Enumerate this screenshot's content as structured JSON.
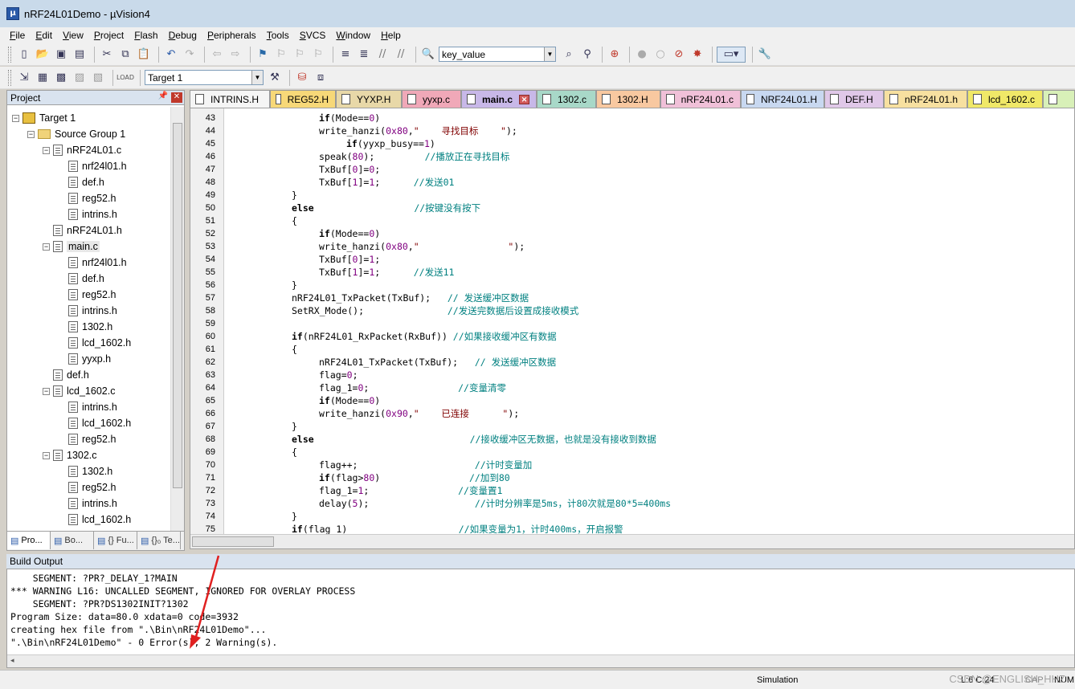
{
  "window": {
    "title": "nRF24L01Demo  - µVision4"
  },
  "menu": [
    "File",
    "Edit",
    "View",
    "Project",
    "Flash",
    "Debug",
    "Peripherals",
    "Tools",
    "SVCS",
    "Window",
    "Help"
  ],
  "toolbar": {
    "find_combo_value": "key_value",
    "target_combo_value": "Target 1"
  },
  "project_panel": {
    "title": "Project",
    "tree": [
      {
        "label": "Target 1",
        "level": 0,
        "kind": "target",
        "expander": "-"
      },
      {
        "label": "Source Group 1",
        "level": 1,
        "kind": "folder",
        "expander": "-"
      },
      {
        "label": "nRF24L01.c",
        "level": 2,
        "kind": "file",
        "expander": "-"
      },
      {
        "label": "nrf24l01.h",
        "level": 3,
        "kind": "file"
      },
      {
        "label": "def.h",
        "level": 3,
        "kind": "file"
      },
      {
        "label": "reg52.h",
        "level": 3,
        "kind": "file"
      },
      {
        "label": "intrins.h",
        "level": 3,
        "kind": "file"
      },
      {
        "label": "nRF24L01.h",
        "level": 2,
        "kind": "file"
      },
      {
        "label": "main.c",
        "level": 2,
        "kind": "file",
        "expander": "-"
      },
      {
        "label": "nrf24l01.h",
        "level": 3,
        "kind": "file"
      },
      {
        "label": "def.h",
        "level": 3,
        "kind": "file"
      },
      {
        "label": "reg52.h",
        "level": 3,
        "kind": "file"
      },
      {
        "label": "intrins.h",
        "level": 3,
        "kind": "file"
      },
      {
        "label": "1302.h",
        "level": 3,
        "kind": "file"
      },
      {
        "label": "lcd_1602.h",
        "level": 3,
        "kind": "file"
      },
      {
        "label": "yyxp.h",
        "level": 3,
        "kind": "file"
      },
      {
        "label": "def.h",
        "level": 2,
        "kind": "file"
      },
      {
        "label": "lcd_1602.c",
        "level": 2,
        "kind": "file",
        "expander": "-"
      },
      {
        "label": "intrins.h",
        "level": 3,
        "kind": "file"
      },
      {
        "label": "lcd_1602.h",
        "level": 3,
        "kind": "file"
      },
      {
        "label": "reg52.h",
        "level": 3,
        "kind": "file"
      },
      {
        "label": "1302.c",
        "level": 2,
        "kind": "file",
        "expander": "-"
      },
      {
        "label": "1302.h",
        "level": 3,
        "kind": "file"
      },
      {
        "label": "reg52.h",
        "level": 3,
        "kind": "file"
      },
      {
        "label": "intrins.h",
        "level": 3,
        "kind": "file"
      },
      {
        "label": "lcd_1602.h",
        "level": 3,
        "kind": "file"
      }
    ],
    "tabs": [
      "Pro...",
      "Bo...",
      "{} Fu...",
      "{}₀ Te..."
    ]
  },
  "editor": {
    "tabs": [
      {
        "label": "INTRINS.H",
        "color": "#f5f5f5"
      },
      {
        "label": "REG52.H",
        "color": "#f7d878"
      },
      {
        "label": "YYXP.H",
        "color": "#e8d8a8"
      },
      {
        "label": "yyxp.c",
        "color": "#f0a8b8"
      },
      {
        "label": "main.c",
        "color": "#c8b8e8",
        "active": true
      },
      {
        "label": "1302.c",
        "color": "#a8d8c8"
      },
      {
        "label": "1302.H",
        "color": "#f8c8a0"
      },
      {
        "label": "nRF24L01.c",
        "color": "#f0c0d8"
      },
      {
        "label": "NRF24L01.H",
        "color": "#c8d8f0"
      },
      {
        "label": "DEF.H",
        "color": "#e0c8e8"
      },
      {
        "label": "nRF24L01.h",
        "color": "#f7e0a0"
      },
      {
        "label": "lcd_1602.c",
        "color": "#f0e868"
      },
      {
        "label": "",
        "color": "#d8f0b8"
      }
    ],
    "lines": [
      {
        "n": "43",
        "indent": 12,
        "segs": [
          {
            "t": "if",
            "c": "kw"
          },
          {
            "t": "(Mode=="
          },
          {
            "t": "0",
            "c": "num"
          },
          {
            "t": ")"
          }
        ]
      },
      {
        "n": "44",
        "indent": 12,
        "segs": [
          {
            "t": "write_hanzi("
          },
          {
            "t": "0x80",
            "c": "num"
          },
          {
            "t": ","
          },
          {
            "t": "\"    寻找目标    \"",
            "c": "str"
          },
          {
            "t": ");"
          }
        ]
      },
      {
        "n": "45",
        "indent": 16,
        "segs": [
          {
            "t": "if",
            "c": "kw"
          },
          {
            "t": "(yyxp_busy=="
          },
          {
            "t": "1",
            "c": "num"
          },
          {
            "t": ")"
          }
        ]
      },
      {
        "n": "46",
        "indent": 12,
        "segs": [
          {
            "t": "speak("
          },
          {
            "t": "80",
            "c": "num"
          },
          {
            "t": ");         "
          },
          {
            "t": "//播放正在寻找目标",
            "c": "cmt"
          }
        ]
      },
      {
        "n": "47",
        "indent": 12,
        "segs": [
          {
            "t": "TxBuf["
          },
          {
            "t": "0",
            "c": "num"
          },
          {
            "t": "]="
          },
          {
            "t": "0",
            "c": "num"
          },
          {
            "t": ";"
          }
        ]
      },
      {
        "n": "48",
        "indent": 12,
        "segs": [
          {
            "t": "TxBuf["
          },
          {
            "t": "1",
            "c": "num"
          },
          {
            "t": "]="
          },
          {
            "t": "1",
            "c": "num"
          },
          {
            "t": ";      "
          },
          {
            "t": "//发送01",
            "c": "cmt"
          }
        ]
      },
      {
        "n": "49",
        "indent": 8,
        "segs": [
          {
            "t": "}"
          }
        ]
      },
      {
        "n": "50",
        "indent": 8,
        "segs": [
          {
            "t": "else",
            "c": "kw"
          },
          {
            "t": "                  "
          },
          {
            "t": "//按键没有按下",
            "c": "cmt"
          }
        ]
      },
      {
        "n": "51",
        "indent": 8,
        "segs": [
          {
            "t": "{"
          }
        ]
      },
      {
        "n": "52",
        "indent": 12,
        "segs": [
          {
            "t": "if",
            "c": "kw"
          },
          {
            "t": "(Mode=="
          },
          {
            "t": "0",
            "c": "num"
          },
          {
            "t": ")"
          }
        ]
      },
      {
        "n": "53",
        "indent": 12,
        "segs": [
          {
            "t": "write_hanzi("
          },
          {
            "t": "0x80",
            "c": "num"
          },
          {
            "t": ","
          },
          {
            "t": "\"                \"",
            "c": "str"
          },
          {
            "t": ");"
          }
        ]
      },
      {
        "n": "54",
        "indent": 12,
        "segs": [
          {
            "t": "TxBuf["
          },
          {
            "t": "0",
            "c": "num"
          },
          {
            "t": "]="
          },
          {
            "t": "1",
            "c": "num"
          },
          {
            "t": ";"
          }
        ]
      },
      {
        "n": "55",
        "indent": 12,
        "segs": [
          {
            "t": "TxBuf["
          },
          {
            "t": "1",
            "c": "num"
          },
          {
            "t": "]="
          },
          {
            "t": "1",
            "c": "num"
          },
          {
            "t": ";      "
          },
          {
            "t": "//发送11",
            "c": "cmt"
          }
        ]
      },
      {
        "n": "56",
        "indent": 8,
        "segs": [
          {
            "t": "}"
          }
        ]
      },
      {
        "n": "57",
        "indent": 8,
        "segs": [
          {
            "t": "nRF24L01_TxPacket(TxBuf);   "
          },
          {
            "t": "// 发送缓冲区数据",
            "c": "cmt"
          }
        ]
      },
      {
        "n": "58",
        "indent": 8,
        "segs": [
          {
            "t": "SetRX_Mode();               "
          },
          {
            "t": "//发送完数据后设置成接收模式",
            "c": "cmt"
          }
        ]
      },
      {
        "n": "59",
        "indent": 8,
        "segs": [
          {
            "t": ""
          }
        ]
      },
      {
        "n": "60",
        "indent": 8,
        "segs": [
          {
            "t": "if",
            "c": "kw"
          },
          {
            "t": "(nRF24L01_RxPacket(RxBuf)) "
          },
          {
            "t": "//如果接收缓冲区有数据",
            "c": "cmt"
          }
        ]
      },
      {
        "n": "61",
        "indent": 8,
        "segs": [
          {
            "t": "{"
          }
        ]
      },
      {
        "n": "62",
        "indent": 12,
        "segs": [
          {
            "t": "nRF24L01_TxPacket(TxBuf);   "
          },
          {
            "t": "// 发送缓冲区数据",
            "c": "cmt"
          }
        ]
      },
      {
        "n": "63",
        "indent": 12,
        "segs": [
          {
            "t": "flag="
          },
          {
            "t": "0",
            "c": "num"
          },
          {
            "t": ";"
          }
        ]
      },
      {
        "n": "64",
        "indent": 12,
        "segs": [
          {
            "t": "flag_1="
          },
          {
            "t": "0",
            "c": "num"
          },
          {
            "t": ";                "
          },
          {
            "t": "//变量清零",
            "c": "cmt"
          }
        ]
      },
      {
        "n": "65",
        "indent": 12,
        "segs": [
          {
            "t": "if",
            "c": "kw"
          },
          {
            "t": "(Mode=="
          },
          {
            "t": "0",
            "c": "num"
          },
          {
            "t": ")"
          }
        ]
      },
      {
        "n": "66",
        "indent": 12,
        "segs": [
          {
            "t": "write_hanzi("
          },
          {
            "t": "0x90",
            "c": "num"
          },
          {
            "t": ","
          },
          {
            "t": "\"    已连接      \"",
            "c": "str"
          },
          {
            "t": ");"
          }
        ]
      },
      {
        "n": "67",
        "indent": 8,
        "segs": [
          {
            "t": "}"
          }
        ]
      },
      {
        "n": "68",
        "indent": 8,
        "segs": [
          {
            "t": "else",
            "c": "kw"
          },
          {
            "t": "                            "
          },
          {
            "t": "//接收缓冲区无数据，也就是没有接收到数据",
            "c": "cmt"
          }
        ]
      },
      {
        "n": "69",
        "indent": 8,
        "segs": [
          {
            "t": "{"
          }
        ]
      },
      {
        "n": "70",
        "indent": 12,
        "segs": [
          {
            "t": "flag++;                     "
          },
          {
            "t": "//计时变量加",
            "c": "cmt"
          }
        ]
      },
      {
        "n": "71",
        "indent": 12,
        "segs": [
          {
            "t": "if",
            "c": "kw"
          },
          {
            "t": "(flag>"
          },
          {
            "t": "80",
            "c": "num"
          },
          {
            "t": ")                "
          },
          {
            "t": "//加到80",
            "c": "cmt"
          }
        ]
      },
      {
        "n": "72",
        "indent": 12,
        "segs": [
          {
            "t": "flag_1="
          },
          {
            "t": "1",
            "c": "num"
          },
          {
            "t": ";                "
          },
          {
            "t": "//变量置1",
            "c": "cmt"
          }
        ]
      },
      {
        "n": "73",
        "indent": 12,
        "segs": [
          {
            "t": "delay("
          },
          {
            "t": "5",
            "c": "num"
          },
          {
            "t": ");                   "
          },
          {
            "t": "//计时分辨率是5ms，计80次就是80*5=400ms",
            "c": "cmt"
          }
        ]
      },
      {
        "n": "74",
        "indent": 8,
        "segs": [
          {
            "t": "}"
          }
        ]
      },
      {
        "n": "75",
        "indent": 8,
        "segs": [
          {
            "t": "if",
            "c": "kw"
          },
          {
            "t": "(flag_1)                    "
          },
          {
            "t": "//如果变量为1，计时400ms，开启报警",
            "c": "cmt"
          }
        ]
      }
    ]
  },
  "build_output": {
    "title": "Build Output",
    "lines": [
      "    SEGMENT: ?PR?_DELAY_1?MAIN",
      "*** WARNING L16: UNCALLED SEGMENT, IGNORED FOR OVERLAY PROCESS",
      "    SEGMENT: ?PR?DS1302INIT?1302",
      "Program Size: data=80.0 xdata=0 code=3932",
      "creating hex file from \".\\Bin\\nRF24L01Demo\"...",
      "\".\\Bin\\nRF24L01Demo\" - 0 Error(s), 2 Warning(s)."
    ]
  },
  "status": {
    "mode": "Simulation",
    "position": "L:6 C:24",
    "cap": "CAP",
    "num": "NUM"
  },
  "watermark": "CSDN @ENGLISH_HHZ"
}
